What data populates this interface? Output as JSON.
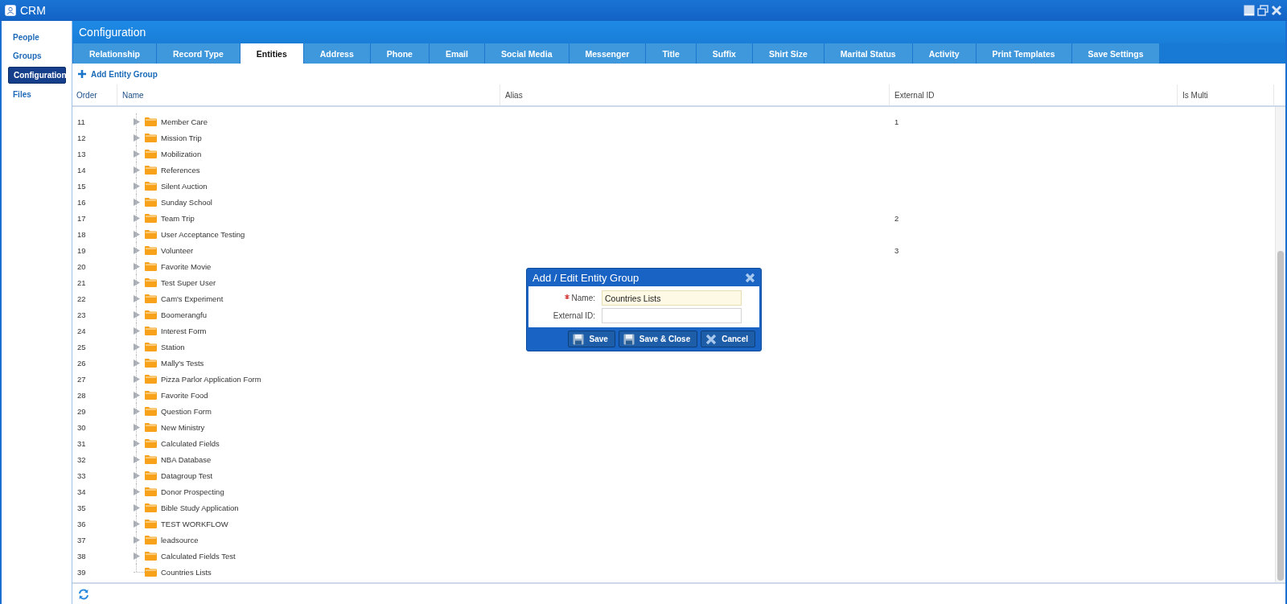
{
  "window": {
    "title": "CRM"
  },
  "sidebar": {
    "items": [
      {
        "label": "People",
        "selected": false
      },
      {
        "label": "Groups",
        "selected": false
      },
      {
        "label": "Configuration",
        "selected": true
      },
      {
        "label": "Files",
        "selected": false
      }
    ]
  },
  "panel": {
    "title": "Configuration"
  },
  "tabs": [
    {
      "label": "Relationship",
      "selected": false
    },
    {
      "label": "Record Type",
      "selected": false
    },
    {
      "label": "Entities",
      "selected": true
    },
    {
      "label": "Address",
      "selected": false
    },
    {
      "label": "Phone",
      "selected": false
    },
    {
      "label": "Email",
      "selected": false
    },
    {
      "label": "Social Media",
      "selected": false
    },
    {
      "label": "Messenger",
      "selected": false
    },
    {
      "label": "Title",
      "selected": false
    },
    {
      "label": "Suffix",
      "selected": false
    },
    {
      "label": "Shirt Size",
      "selected": false
    },
    {
      "label": "Marital Status",
      "selected": false
    },
    {
      "label": "Activity",
      "selected": false
    },
    {
      "label": "Print Templates",
      "selected": false
    },
    {
      "label": "Save Settings",
      "selected": false
    }
  ],
  "toolbar": {
    "add_button": "Add Entity Group"
  },
  "table": {
    "columns": [
      "Order",
      "Name",
      "Alias",
      "External ID",
      "Is Multi"
    ],
    "rows": [
      {
        "order": "11",
        "name": "Member Care",
        "external_id": "1",
        "expandable": true
      },
      {
        "order": "12",
        "name": "Mission Trip",
        "expandable": true
      },
      {
        "order": "13",
        "name": "Mobilization",
        "expandable": true
      },
      {
        "order": "14",
        "name": "References",
        "expandable": true
      },
      {
        "order": "15",
        "name": "Silent Auction",
        "expandable": true
      },
      {
        "order": "16",
        "name": "Sunday School",
        "expandable": true
      },
      {
        "order": "17",
        "name": "Team Trip",
        "external_id": "2",
        "expandable": true
      },
      {
        "order": "18",
        "name": "User Acceptance Testing",
        "expandable": true
      },
      {
        "order": "19",
        "name": "Volunteer",
        "external_id": "3",
        "expandable": true
      },
      {
        "order": "20",
        "name": "Favorite Movie",
        "expandable": true
      },
      {
        "order": "21",
        "name": "Test Super User",
        "expandable": true
      },
      {
        "order": "22",
        "name": "Cam's Experiment",
        "expandable": true
      },
      {
        "order": "23",
        "name": "Boomerangfu",
        "expandable": true
      },
      {
        "order": "24",
        "name": "Interest Form",
        "expandable": true
      },
      {
        "order": "25",
        "name": "Station",
        "expandable": true
      },
      {
        "order": "26",
        "name": "Mally's Tests",
        "expandable": true
      },
      {
        "order": "27",
        "name": "Pizza Parlor Application Form",
        "expandable": true
      },
      {
        "order": "28",
        "name": "Favorite Food",
        "expandable": true
      },
      {
        "order": "29",
        "name": "Question Form",
        "expandable": true
      },
      {
        "order": "30",
        "name": "New Ministry",
        "expandable": true
      },
      {
        "order": "31",
        "name": "Calculated Fields",
        "expandable": true
      },
      {
        "order": "32",
        "name": "NBA Database",
        "expandable": true
      },
      {
        "order": "33",
        "name": "Datagroup Test",
        "expandable": true
      },
      {
        "order": "34",
        "name": "Donor Prospecting",
        "expandable": true
      },
      {
        "order": "35",
        "name": "Bible Study Application",
        "expandable": true
      },
      {
        "order": "36",
        "name": "TEST WORKFLOW",
        "expandable": true
      },
      {
        "order": "37",
        "name": "leadsource",
        "expandable": true
      },
      {
        "order": "38",
        "name": "Calculated Fields Test",
        "expandable": true
      },
      {
        "order": "39",
        "name": "Countries Lists",
        "expandable": false
      }
    ]
  },
  "dialog": {
    "title": "Add / Edit Entity Group",
    "fields": [
      {
        "label": "Name:",
        "value": "Countries Lists",
        "required": true,
        "focused": true
      },
      {
        "label": "External ID:",
        "required": false,
        "focused": false
      }
    ],
    "buttons": [
      {
        "label": "Save",
        "kind": "save"
      },
      {
        "label": "Save & Close",
        "kind": "save"
      },
      {
        "label": "Cancel",
        "kind": "cancel"
      }
    ]
  }
}
